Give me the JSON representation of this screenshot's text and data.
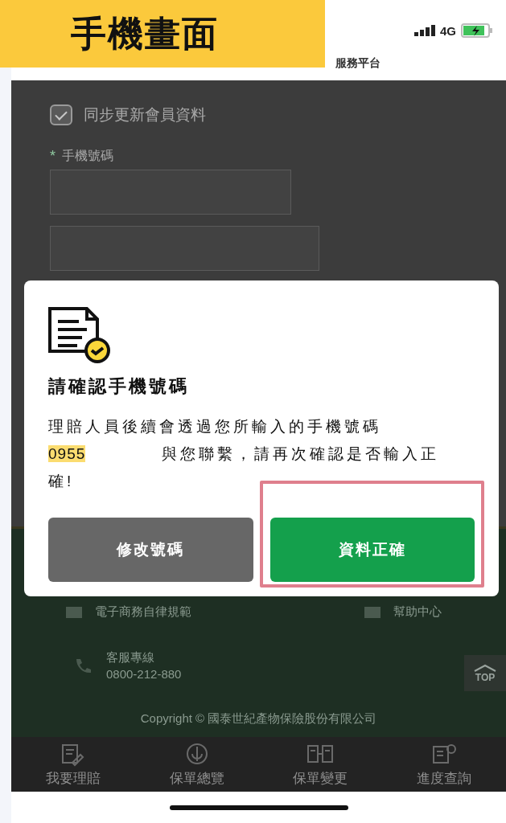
{
  "banner": {
    "title": "手機畫面"
  },
  "status_bar": {
    "network": "4G"
  },
  "header": {
    "title": "服務平台"
  },
  "form": {
    "sync_checkbox": {
      "label": "同步更新會員資料",
      "checked": true
    },
    "required_mark": "*",
    "phone_label": "手機號碼"
  },
  "dialog": {
    "title": "請確認手機號碼",
    "message_start": "理賠人員後續會透過您所輸入的手機號碼",
    "phone": "0955",
    "message_end": "與您聯繫，請再次確認是否輸入正確!",
    "buttons": [
      {
        "label": "修改號碼",
        "kind": "secondary",
        "highlighted": false
      },
      {
        "label": "資料正確",
        "kind": "primary",
        "highlighted": true
      }
    ]
  },
  "footer": {
    "links": [
      "電子商務自律規範",
      "幫助中心"
    ],
    "hotline_label": "客服專線",
    "hotline": "0800-212-880",
    "top_button": "TOP",
    "copyright": "Copyright © 國泰世紀產物保險股份有限公司"
  },
  "bottom_nav": [
    {
      "label": "我要理賠",
      "kind": "claim"
    },
    {
      "label": "保單總覽",
      "kind": "overview"
    },
    {
      "label": "保單變更",
      "kind": "change"
    },
    {
      "label": "進度查詢",
      "kind": "progress"
    }
  ]
}
